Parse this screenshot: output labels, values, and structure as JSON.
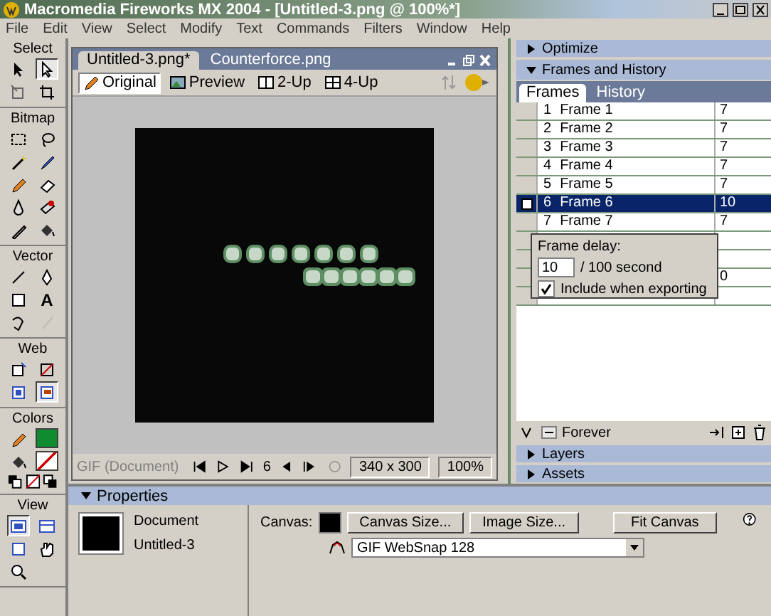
{
  "window": {
    "title": "Macromedia Fireworks MX 2004 - [Untitled-3.png @ 100%*]"
  },
  "menu": [
    "File",
    "Edit",
    "View",
    "Select",
    "Modify",
    "Text",
    "Commands",
    "Filters",
    "Window",
    "Help"
  ],
  "toolbox": [
    {
      "title": "Select",
      "tools": [
        {
          "selected": false
        },
        {
          "selected": true
        },
        {
          "selected": false
        },
        {
          "selected": false
        }
      ]
    },
    {
      "title": "Bitmap",
      "tools": [
        {
          "selected": false
        },
        {
          "selected": false
        },
        {
          "selected": false
        },
        {
          "selected": false
        },
        {
          "selected": false
        },
        {
          "selected": false
        },
        {
          "selected": false
        },
        {
          "selected": false
        },
        {
          "selected": false
        },
        {
          "selected": false
        }
      ]
    },
    {
      "title": "Vector",
      "tools": [
        {
          "selected": false
        },
        {
          "selected": false
        },
        {
          "selected": false
        },
        {
          "selected": false
        },
        {
          "selected": false
        },
        {
          "selected": false
        }
      ]
    },
    {
      "title": "Web",
      "tools": [
        {
          "selected": false
        },
        {
          "selected": false
        },
        {
          "selected": false
        },
        {
          "selected": true
        }
      ]
    },
    {
      "title": "Colors"
    },
    {
      "title": "View",
      "tools": [
        {
          "selected": true
        },
        {
          "selected": false
        },
        {
          "selected": false
        },
        {
          "selected": false
        },
        {
          "selected": false
        }
      ]
    }
  ],
  "text_tool_glyph": "A",
  "document": {
    "tabs": [
      {
        "label": "Untitled-3.png*",
        "selected": true
      },
      {
        "label": "Counterforce.png",
        "selected": false
      }
    ],
    "views": [
      {
        "label": "Original",
        "selected": true
      },
      {
        "label": "Preview",
        "selected": false
      },
      {
        "label": "2-Up",
        "selected": false
      },
      {
        "label": "4-Up",
        "selected": false
      }
    ],
    "status": {
      "format": "GIF (Document)",
      "frame": "6",
      "size": "340 x 300",
      "zoom": "100%"
    }
  },
  "panels": {
    "optimize": {
      "title": "Optimize",
      "expanded": false
    },
    "frames_history": {
      "title": "Frames and History",
      "expanded": true,
      "tabs": [
        {
          "label": "Frames",
          "selected": true
        },
        {
          "label": "History",
          "selected": false
        }
      ],
      "frames": [
        {
          "kind": "frame",
          "number": "1",
          "name": "Frame 1",
          "delay": "7",
          "selected": false
        },
        {
          "kind": "frame",
          "number": "2",
          "name": "Frame 2",
          "delay": "7",
          "selected": false
        },
        {
          "kind": "frame",
          "number": "3",
          "name": "Frame 3",
          "delay": "7",
          "selected": false
        },
        {
          "kind": "frame",
          "number": "4",
          "name": "Frame 4",
          "delay": "7",
          "selected": false
        },
        {
          "kind": "frame",
          "number": "5",
          "name": "Frame 5",
          "delay": "7",
          "selected": false
        },
        {
          "kind": "frame",
          "number": "6",
          "name": "Frame 6",
          "delay": "10",
          "selected": true
        },
        {
          "kind": "frame",
          "number": "7",
          "name": "Frame 7",
          "delay": "7",
          "selected": false
        },
        {
          "kind": "covered",
          "selected": false
        },
        {
          "kind": "covered",
          "selected": false
        },
        {
          "kind": "covered",
          "delay": "0",
          "selected": false
        },
        {
          "kind": "covered",
          "selected": false
        }
      ],
      "delay_popup": {
        "label": "Frame delay:",
        "value": "10",
        "unit": "/ 100 second",
        "include_label": "Include when exporting",
        "include_checked": true
      },
      "loop": "Forever"
    },
    "layers": {
      "title": "Layers",
      "expanded": false
    },
    "assets": {
      "title": "Assets",
      "expanded": false
    }
  },
  "properties": {
    "title": "Properties",
    "kind_label": "Document",
    "doc_name": "Untitled-3",
    "canvas_label": "Canvas:",
    "canvas_size_button": "Canvas Size...",
    "image_size_button": "Image Size...",
    "fit_canvas_button": "Fit Canvas",
    "optimize_setting": "GIF WebSnap 128"
  }
}
